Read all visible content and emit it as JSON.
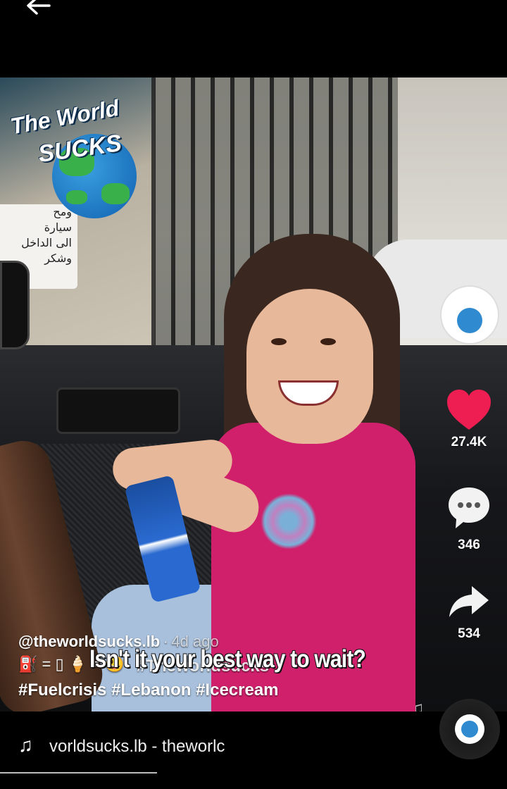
{
  "nav": {
    "back_icon": "arrow-left-icon"
  },
  "video": {
    "logo": {
      "line1": "The World",
      "line2": "SUCKS"
    },
    "sign_lines": [
      "ومح",
      "سيارة",
      "الى الداخل",
      "وشكر"
    ],
    "burned_caption": "Isn't it your best way to wait?"
  },
  "sidebar": {
    "avatar_icon": "profile-avatar",
    "like": {
      "icon": "heart-icon",
      "count": "27.4K",
      "color": "#ee1d52"
    },
    "comment": {
      "icon": "comment-icon",
      "count": "346"
    },
    "share": {
      "icon": "share-icon",
      "count": "534"
    }
  },
  "caption": {
    "author": "@theworldsucks.lb",
    "separator": "·",
    "date": "4d ago",
    "emojis": "⛽ = ▯ 🍦 = 😃",
    "hashtag_line1": "#Theworldsucks",
    "hashtag_line2": "#Fuelcrisis #Lebanon #Icecream"
  },
  "music": {
    "icon": "music-note-icon",
    "sound_text": "vorldsucks.lb - theworlc",
    "progress": 0.31
  }
}
